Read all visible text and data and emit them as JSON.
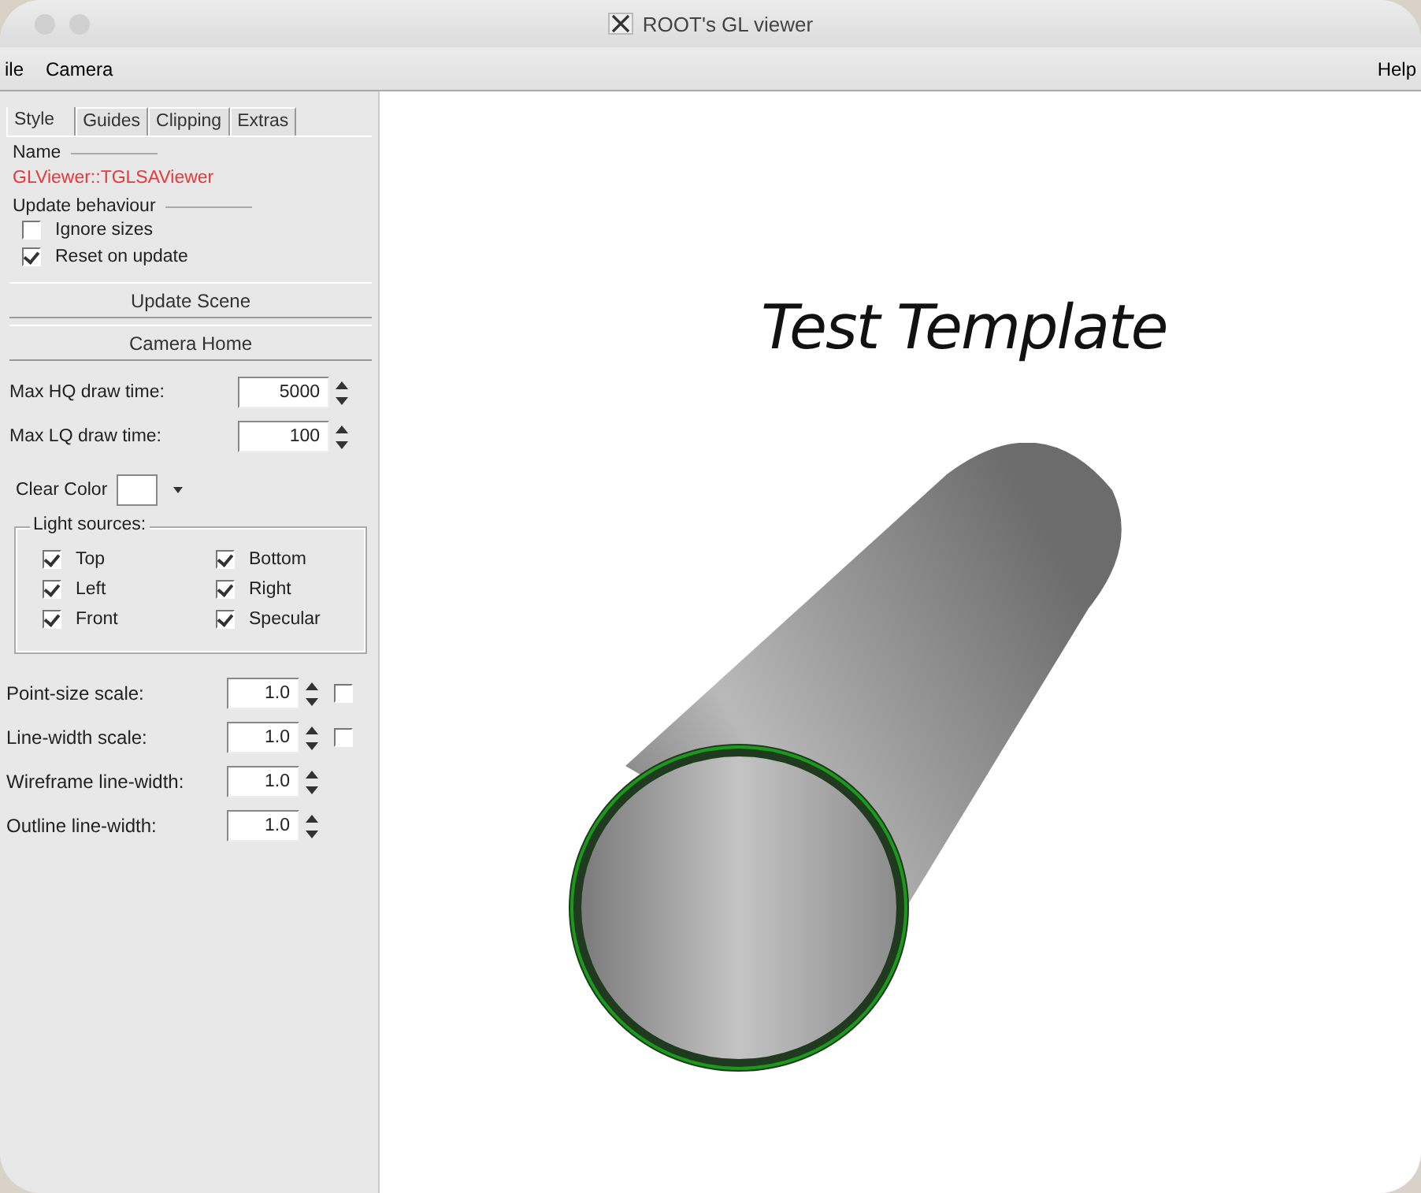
{
  "window": {
    "title": "ROOT's GL viewer"
  },
  "menu": [
    "ile",
    "Camera",
    "Help"
  ],
  "tabs": [
    {
      "label": "Style",
      "selected": true
    },
    {
      "label": "Guides",
      "selected": false
    },
    {
      "label": "Clipping",
      "selected": false
    },
    {
      "label": "Extras",
      "selected": false
    }
  ],
  "name_section": {
    "label": "Name",
    "value": "GLViewer::TGLSAViewer"
  },
  "update_section": {
    "label": "Update behaviour",
    "options": [
      {
        "label": "Ignore sizes",
        "checked": false
      },
      {
        "label": "Reset on update",
        "checked": true
      }
    ]
  },
  "buttons": [
    "Update Scene",
    "Camera Home"
  ],
  "draw_times": [
    {
      "label": "Max HQ draw time:",
      "value": "5000"
    },
    {
      "label": "Max LQ draw time:",
      "value": "100"
    }
  ],
  "clear_color": {
    "label": "Clear Color"
  },
  "light_sources": {
    "label": "Light sources:",
    "items": [
      {
        "label": "Top",
        "checked": true
      },
      {
        "label": "Bottom",
        "checked": true
      },
      {
        "label": "Left",
        "checked": true
      },
      {
        "label": "Right",
        "checked": true
      },
      {
        "label": "Front",
        "checked": true
      },
      {
        "label": "Specular",
        "checked": true
      }
    ]
  },
  "scales": [
    {
      "kind": "spin_check",
      "label": "Point-size scale:",
      "value": "1.0",
      "checked": false
    },
    {
      "kind": "spin_check",
      "label": "Line-width scale:",
      "value": "1.0",
      "checked": false
    },
    {
      "kind": "spin",
      "label": "Wireframe line-width:",
      "value": "1.0"
    },
    {
      "kind": "spin",
      "label": "Outline line-width:",
      "value": "1.0"
    }
  ],
  "viewer": {
    "title": "Test Template"
  }
}
